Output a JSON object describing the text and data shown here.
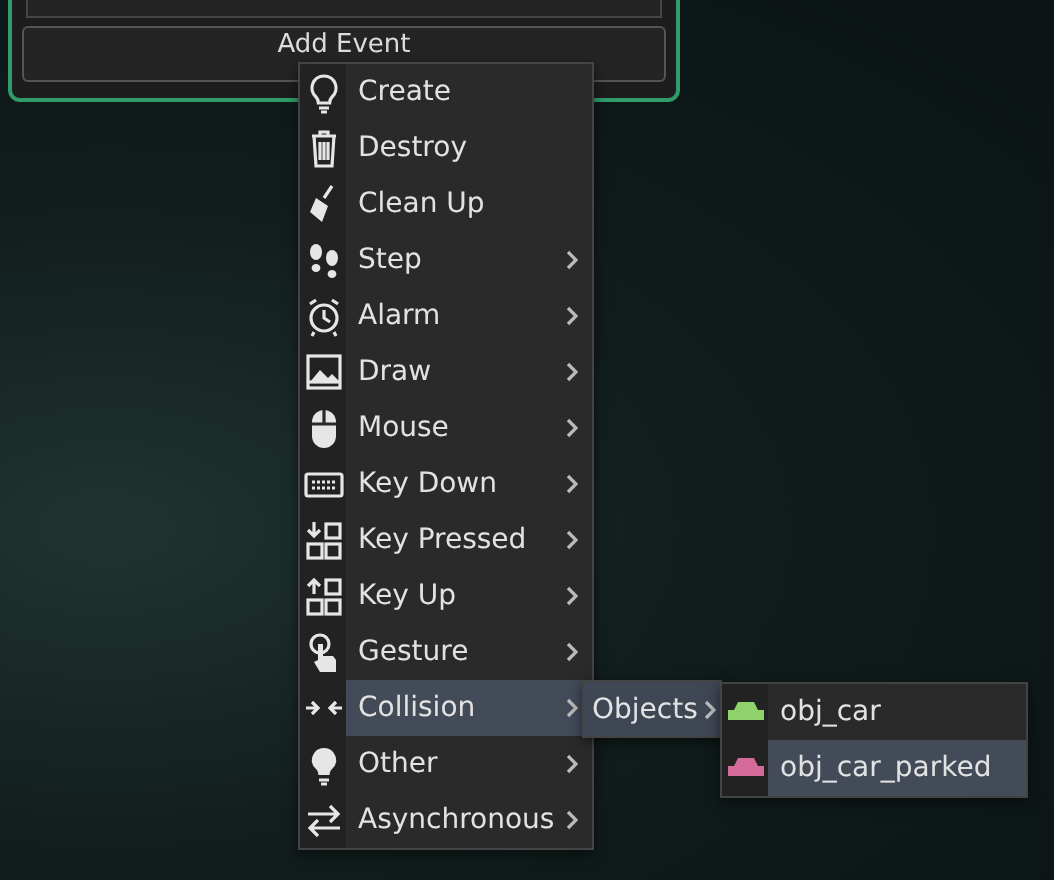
{
  "panel": {
    "button": "Add Event"
  },
  "menu": {
    "items": [
      {
        "label": "Create",
        "submenu": false,
        "selected": false
      },
      {
        "label": "Destroy",
        "submenu": false,
        "selected": false
      },
      {
        "label": "Clean Up",
        "submenu": false,
        "selected": false
      },
      {
        "label": "Step",
        "submenu": true,
        "selected": false
      },
      {
        "label": "Alarm",
        "submenu": true,
        "selected": false
      },
      {
        "label": "Draw",
        "submenu": true,
        "selected": false
      },
      {
        "label": "Mouse",
        "submenu": true,
        "selected": false
      },
      {
        "label": "Key Down",
        "submenu": true,
        "selected": false
      },
      {
        "label": "Key Pressed",
        "submenu": true,
        "selected": false
      },
      {
        "label": "Key Up",
        "submenu": true,
        "selected": false
      },
      {
        "label": "Gesture",
        "submenu": true,
        "selected": false
      },
      {
        "label": "Collision",
        "submenu": true,
        "selected": true
      },
      {
        "label": "Other",
        "submenu": true,
        "selected": false
      },
      {
        "label": "Asynchronous",
        "submenu": true,
        "selected": false
      }
    ]
  },
  "submenu": {
    "items": [
      {
        "label": "Objects",
        "submenu": true,
        "selected": true
      }
    ]
  },
  "objects": {
    "items": [
      {
        "label": "obj_car",
        "color": "#8fd16a",
        "selected": false
      },
      {
        "label": "obj_car_parked",
        "color": "#d46a9a",
        "selected": true
      }
    ]
  }
}
